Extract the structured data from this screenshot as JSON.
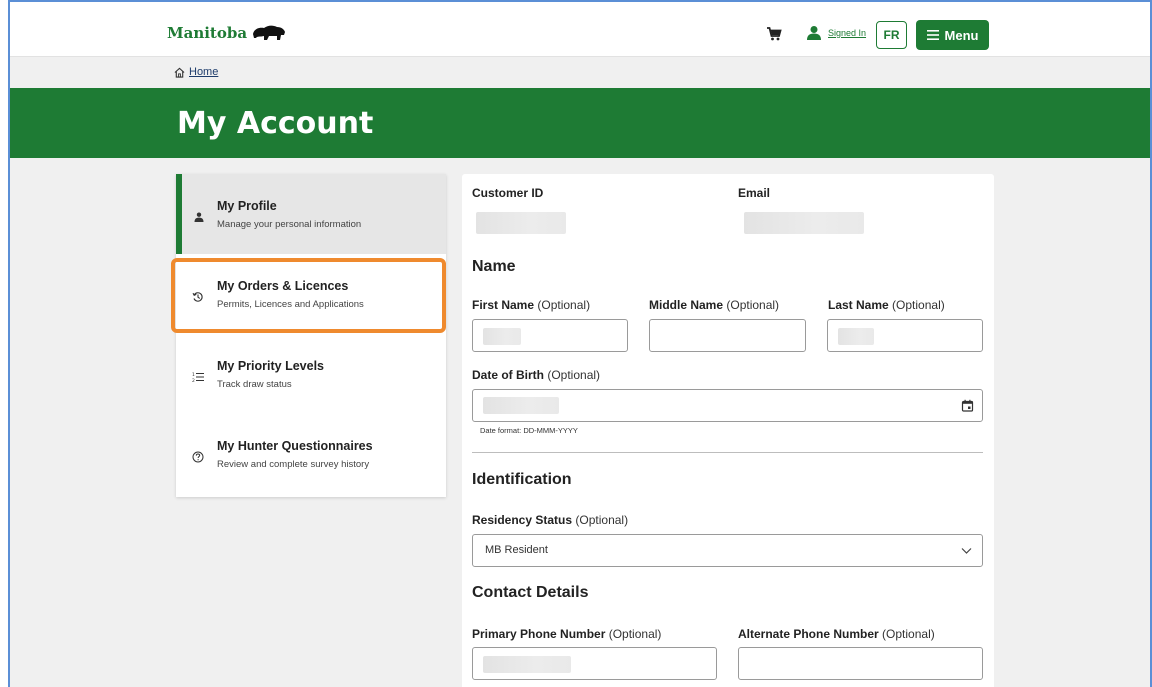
{
  "header": {
    "logo_text": "Manitoba",
    "signed_in_label": "Signed In",
    "lang_button": "FR",
    "menu_button": "Menu"
  },
  "breadcrumb": {
    "home_label": "Home"
  },
  "page": {
    "title": "My Account"
  },
  "sidebar": {
    "items": [
      {
        "title": "My Profile",
        "subtitle": "Manage your personal information",
        "icon": "person-icon"
      },
      {
        "title": "My Orders & Licences",
        "subtitle": "Permits, Licences and Applications",
        "icon": "history-icon"
      },
      {
        "title": "My Priority Levels",
        "subtitle": "Track draw status",
        "icon": "list-ordered-icon"
      },
      {
        "title": "My Hunter Questionnaires",
        "subtitle": "Review and complete survey history",
        "icon": "question-circle-icon"
      }
    ]
  },
  "profile": {
    "customer_id_label": "Customer ID",
    "email_label": "Email",
    "name_section": "Name",
    "first_name_label": "First Name",
    "middle_name_label": "Middle Name",
    "last_name_label": "Last Name",
    "optional_suffix": "(Optional)",
    "dob_label": "Date of Birth",
    "date_format_hint": "Date format: DD-MMM-YYYY",
    "identification_section": "Identification",
    "residency_label": "Residency Status",
    "residency_value": "MB Resident",
    "contact_section": "Contact Details",
    "primary_phone_label": "Primary Phone Number",
    "alternate_phone_label": "Alternate Phone Number"
  },
  "colors": {
    "brand_green": "#1e7b34",
    "highlight_orange": "#ef8a2e"
  }
}
